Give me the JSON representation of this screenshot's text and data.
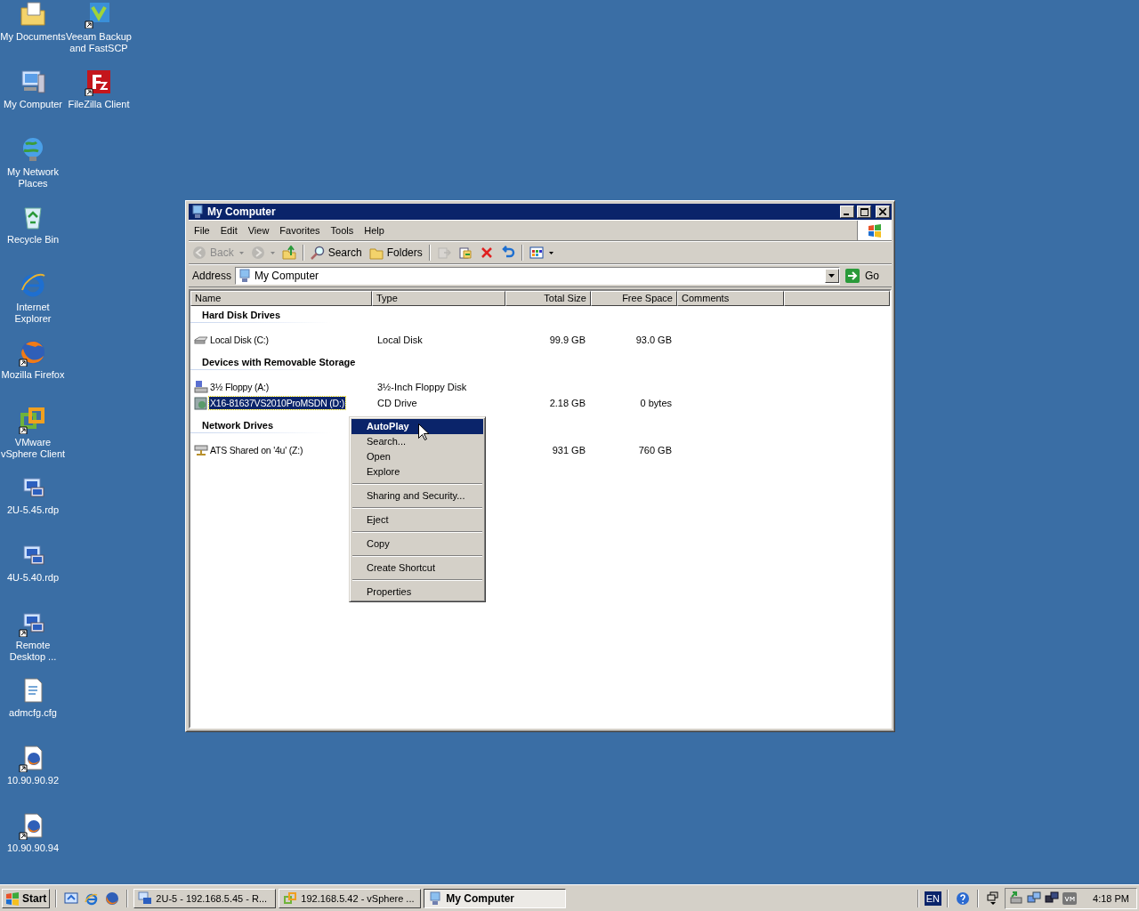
{
  "desktop": {
    "icons": [
      {
        "label": "My Documents",
        "kind": "documents",
        "shortcut": false
      },
      {
        "label": "Veeam Backup and FastSCP",
        "kind": "veeam",
        "shortcut": true
      },
      {
        "label": "My Computer",
        "kind": "computer",
        "shortcut": false
      },
      {
        "label": "FileZilla Client",
        "kind": "filezilla",
        "shortcut": true
      },
      {
        "label": "My Network Places",
        "kind": "network",
        "shortcut": false
      },
      {
        "label": "Recycle Bin",
        "kind": "recycle",
        "shortcut": false
      },
      {
        "label": "Internet Explorer",
        "kind": "ie",
        "shortcut": false
      },
      {
        "label": "Mozilla Firefox",
        "kind": "firefox",
        "shortcut": true
      },
      {
        "label": "VMware vSphere Client",
        "kind": "vmware",
        "shortcut": true
      },
      {
        "label": "2U-5.45.rdp",
        "kind": "rdp",
        "shortcut": false
      },
      {
        "label": "4U-5.40.rdp",
        "kind": "rdp",
        "shortcut": false
      },
      {
        "label": "Remote Desktop ...",
        "kind": "rdp",
        "shortcut": true
      },
      {
        "label": "admcfg.cfg",
        "kind": "file",
        "shortcut": false
      },
      {
        "label": "10.90.90.92",
        "kind": "firefox-doc",
        "shortcut": true
      },
      {
        "label": "10.90.90.94",
        "kind": "firefox-doc",
        "shortcut": true
      }
    ]
  },
  "window": {
    "title": "My Computer",
    "menu": [
      "File",
      "Edit",
      "View",
      "Favorites",
      "Tools",
      "Help"
    ],
    "toolbar": [
      {
        "kind": "back",
        "label": "Back",
        "disabled": true
      },
      {
        "kind": "forward",
        "disabled": true
      },
      {
        "kind": "up",
        "disabled": false
      },
      {
        "kind": "separator"
      },
      {
        "kind": "search",
        "label": "Search",
        "disabled": false
      },
      {
        "kind": "folders",
        "label": "Folders",
        "disabled": false
      },
      {
        "kind": "separator"
      },
      {
        "kind": "moveto",
        "disabled": true
      },
      {
        "kind": "copyto",
        "disabled": false
      },
      {
        "kind": "delete",
        "disabled": false
      },
      {
        "kind": "undo",
        "disabled": false
      },
      {
        "kind": "separator"
      },
      {
        "kind": "views",
        "disabled": false
      }
    ],
    "address": {
      "label": "Address",
      "value": "My Computer",
      "go": "Go"
    },
    "columns": [
      "Name",
      "Type",
      "Total Size",
      "Free Space",
      "Comments"
    ],
    "groups": [
      {
        "title": "Hard Disk Drives",
        "items": [
          {
            "kind": "disk",
            "name": "Local Disk (C:)",
            "type": "Local Disk",
            "total": "99.9 GB",
            "free": "93.0 GB",
            "selected": false
          }
        ]
      },
      {
        "title": "Devices with Removable Storage",
        "items": [
          {
            "kind": "floppy",
            "name": "3½ Floppy (A:)",
            "type": "3½-Inch Floppy Disk",
            "selected": false
          },
          {
            "kind": "cd",
            "name": "X16-81637VS2010ProMSDN (D:)",
            "type": "CD Drive",
            "total": "2.18 GB",
            "free": "0 bytes",
            "selected": true
          }
        ]
      },
      {
        "title": "Network Drives",
        "items": [
          {
            "kind": "netdrive",
            "name": "ATS Shared on '4u' (Z:)",
            "total": "931 GB",
            "free": "760 GB",
            "selected": false
          }
        ]
      }
    ]
  },
  "context_menu": {
    "items": [
      {
        "kind": "item",
        "label": "AutoPlay",
        "default": true,
        "selected": true
      },
      {
        "kind": "item",
        "label": "Search...",
        "default": false,
        "selected": false
      },
      {
        "kind": "item",
        "label": "Open",
        "default": false,
        "selected": false
      },
      {
        "kind": "item",
        "label": "Explore",
        "default": false,
        "selected": false
      },
      {
        "kind": "separator"
      },
      {
        "kind": "item",
        "label": "Sharing and Security...",
        "default": false,
        "selected": false
      },
      {
        "kind": "separator"
      },
      {
        "kind": "item",
        "label": "Eject",
        "default": false,
        "selected": false
      },
      {
        "kind": "separator"
      },
      {
        "kind": "item",
        "label": "Copy",
        "default": false,
        "selected": false
      },
      {
        "kind": "separator"
      },
      {
        "kind": "item",
        "label": "Create Shortcut",
        "default": false,
        "selected": false
      },
      {
        "kind": "separator"
      },
      {
        "kind": "item",
        "label": "Properties",
        "default": false,
        "selected": false
      }
    ]
  },
  "taskbar": {
    "start": "Start",
    "quick_launch": [
      {
        "kind": "desktop"
      },
      {
        "kind": "ie"
      },
      {
        "kind": "firefox"
      }
    ],
    "tasks": [
      {
        "kind": "rdp",
        "label": "2U-5 - 192.168.5.45 - R...",
        "selected": false
      },
      {
        "kind": "vmware",
        "label": "192.168.5.42 - vSphere ...",
        "selected": false
      },
      {
        "kind": "computer",
        "label": "My Computer",
        "selected": true
      }
    ],
    "language": "EN",
    "tray": [
      {
        "kind": "usb"
      },
      {
        "kind": "network"
      },
      {
        "kind": "network-dark"
      },
      {
        "kind": "vm"
      }
    ],
    "clock": "4:18 PM"
  }
}
